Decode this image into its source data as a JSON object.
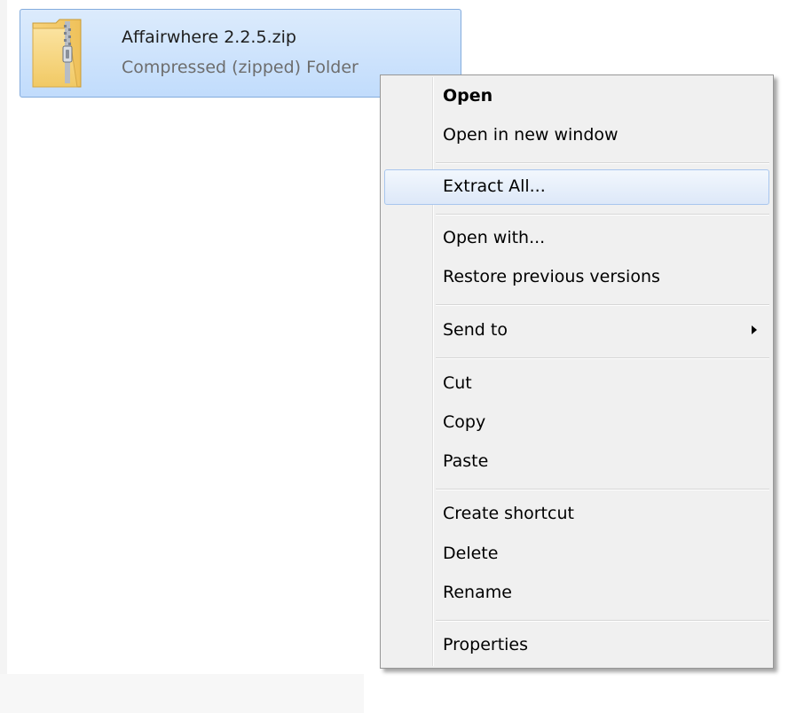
{
  "file": {
    "name": "Affairwhere 2.2.5.zip",
    "type": "Compressed (zipped) Folder",
    "icon": "zip-folder-icon",
    "selected": true
  },
  "context_menu": {
    "items": [
      {
        "label": "Open",
        "bold": true
      },
      {
        "label": "Open in new window"
      },
      {
        "label": "Extract All...",
        "highlighted": true
      },
      {
        "label": "Open with..."
      },
      {
        "label": "Restore previous versions"
      },
      {
        "label": "Send to",
        "submenu": true
      },
      {
        "label": "Cut"
      },
      {
        "label": "Copy"
      },
      {
        "label": "Paste"
      },
      {
        "label": "Create shortcut"
      },
      {
        "label": "Delete"
      },
      {
        "label": "Rename"
      },
      {
        "label": "Properties"
      }
    ],
    "submenu_icon": "chevron-right-icon"
  },
  "colors": {
    "selection_fill": "#c9e0fc",
    "selection_border": "#84acdd",
    "menu_background": "#f0f0f0",
    "hover_border": "#a8c6ee"
  }
}
